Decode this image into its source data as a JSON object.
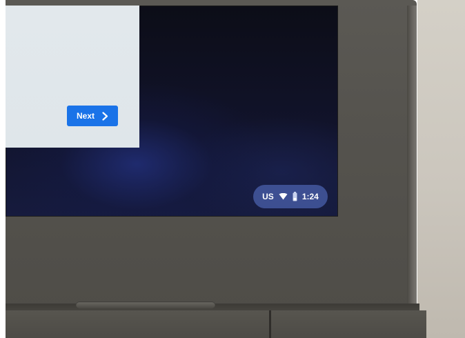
{
  "oobe_dialog": {
    "next_button_label": "Next",
    "next_button_icon": "chevron-right-icon"
  },
  "status_tray": {
    "keyboard_layout": "US",
    "wifi_icon": "wifi-icon",
    "battery_icon": "battery-icon",
    "time": "1:24"
  },
  "colors": {
    "accent": "#1a73e8",
    "dialog_background": "#e2e8ec",
    "screen_background": "#11132a",
    "tray_background": "#485ea8"
  }
}
